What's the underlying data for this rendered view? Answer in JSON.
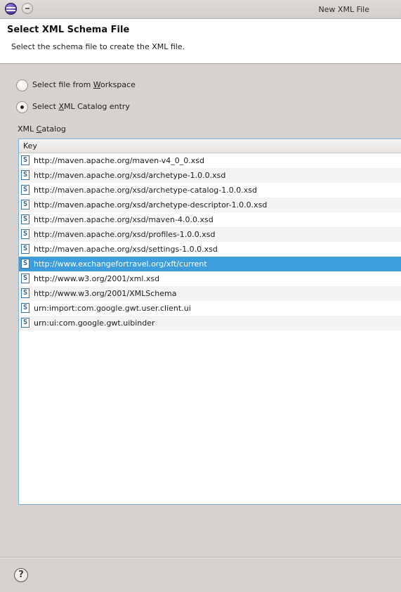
{
  "window": {
    "title": "New XML File"
  },
  "header": {
    "title": "Select XML Schema File",
    "description": "Select the schema file to create the XML file."
  },
  "options": {
    "workspace": {
      "prefix": "Select file from ",
      "mnemonic": "W",
      "suffix": "orkspace",
      "checked": false
    },
    "catalog": {
      "prefix": "Select ",
      "mnemonic": "X",
      "suffix": "ML Catalog entry",
      "checked": true
    }
  },
  "catalog_group": {
    "prefix": "XML ",
    "mnemonic": "C",
    "suffix": "atalog"
  },
  "table": {
    "column": "Key",
    "rows": [
      {
        "key": "http://maven.apache.org/maven-v4_0_0.xsd",
        "icon": "xsd-file-icon",
        "selected": false
      },
      {
        "key": "http://maven.apache.org/xsd/archetype-1.0.0.xsd",
        "icon": "xsd-file-icon",
        "selected": false
      },
      {
        "key": "http://maven.apache.org/xsd/archetype-catalog-1.0.0.xsd",
        "icon": "xsd-file-icon",
        "selected": false
      },
      {
        "key": "http://maven.apache.org/xsd/archetype-descriptor-1.0.0.xsd",
        "icon": "xsd-file-icon",
        "selected": false
      },
      {
        "key": "http://maven.apache.org/xsd/maven-4.0.0.xsd",
        "icon": "xsd-file-icon",
        "selected": false
      },
      {
        "key": "http://maven.apache.org/xsd/profiles-1.0.0.xsd",
        "icon": "xsd-file-icon",
        "selected": false
      },
      {
        "key": "http://maven.apache.org/xsd/settings-1.0.0.xsd",
        "icon": "xsd-file-icon",
        "selected": false
      },
      {
        "key": "http://www.exchangefortravel.org/xft/current",
        "icon": "xsd-file-icon",
        "selected": true
      },
      {
        "key": "http://www.w3.org/2001/xml.xsd",
        "icon": "xsd-file-icon",
        "selected": false
      },
      {
        "key": "http://www.w3.org/2001/XMLSchema",
        "icon": "xsd-file-icon",
        "selected": false
      },
      {
        "key": "urn:import:com.google.gwt.user.client.ui",
        "icon": "xsd-file-icon",
        "selected": false
      },
      {
        "key": "urn:ui:com.google.gwt.uibinder",
        "icon": "xsd-file-icon",
        "selected": false
      }
    ]
  },
  "icon_glyphs": {
    "xsd": "S",
    "help": "?"
  },
  "colors": {
    "selection": "#3d9ddd",
    "table_border": "#7eb1d6"
  }
}
